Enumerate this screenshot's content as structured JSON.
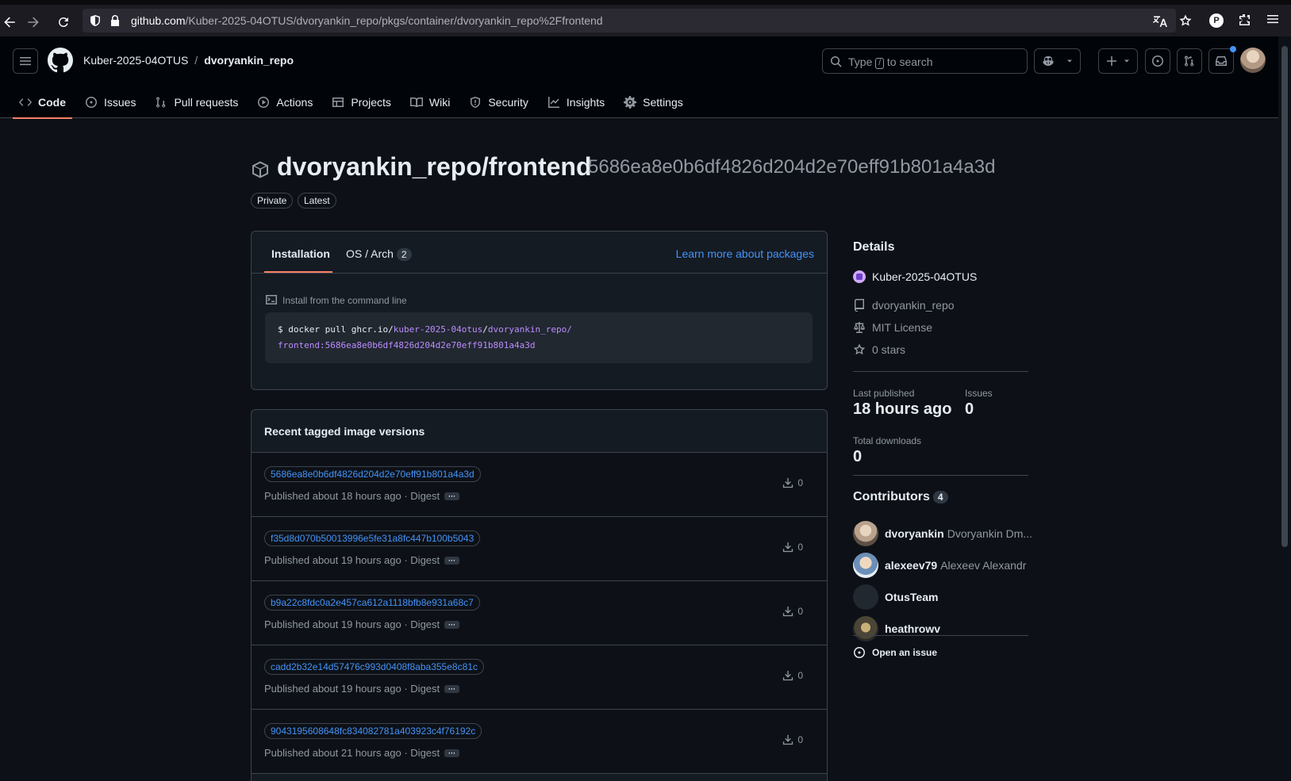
{
  "browser": {
    "url_host": "github.com",
    "url_path": "/Kuber-2025-04OTUS/dvoryankin_repo/pkgs/container/dvoryankin_repo%2Ffrontend",
    "profile_letter": "P"
  },
  "header": {
    "org": "Kuber-2025-04OTUS",
    "sep": "/",
    "repo": "dvoryankin_repo",
    "search_pre": "Type",
    "search_key": "/",
    "search_post": "to search"
  },
  "nav": {
    "tabs": [
      {
        "label": "Code",
        "icon": "code-icon"
      },
      {
        "label": "Issues",
        "icon": "issue-icon"
      },
      {
        "label": "Pull requests",
        "icon": "pull-request-icon"
      },
      {
        "label": "Actions",
        "icon": "play-icon"
      },
      {
        "label": "Projects",
        "icon": "table-icon"
      },
      {
        "label": "Wiki",
        "icon": "book-icon"
      },
      {
        "label": "Security",
        "icon": "shield-icon"
      },
      {
        "label": "Insights",
        "icon": "graph-icon"
      },
      {
        "label": "Settings",
        "icon": "gear-icon"
      }
    ]
  },
  "package": {
    "name": "dvoryankin_repo/frontend",
    "digest": "5686ea8e0b6df4826d204d2e70eff91b801a4a3d",
    "labels": [
      "Private",
      "Latest"
    ]
  },
  "install": {
    "tab_installation": "Installation",
    "tab_os": "OS / Arch",
    "os_count": "2",
    "learn_more": "Learn more about packages",
    "cmd_label": "Install from the command line",
    "cmd_prefix": "$ docker pull ghcr.io/",
    "cmd_owner": "kuber-2025-04otus",
    "cmd_slash": "/",
    "cmd_repo": "dvoryankin_repo/",
    "cmd_line2": "frontend:5686ea8e0b6df4826d204d2e70eff91b801a4a3d"
  },
  "versions": {
    "title": "Recent tagged image versions",
    "rows": [
      {
        "tag": "5686ea8e0b6df4826d204d2e70eff91b801a4a3d",
        "published": "Published about 18 hours ago · Digest",
        "downloads": "0"
      },
      {
        "tag": "f35d8d070b50013996e5fe31a8fc447b100b5043",
        "published": "Published about 19 hours ago · Digest",
        "downloads": "0"
      },
      {
        "tag": "b9a22c8fdc0a2e457ca612a1118bfb8e931a68c7",
        "published": "Published about 19 hours ago · Digest",
        "downloads": "0"
      },
      {
        "tag": "cadd2b32e14d57476c993d0408f8aba355e8c81c",
        "published": "Published about 19 hours ago · Digest",
        "downloads": "0"
      },
      {
        "tag": "9043195608648fc834082781a403923c4f76192c",
        "published": "Published about 21 hours ago · Digest",
        "downloads": "0"
      }
    ],
    "dots": "···"
  },
  "details": {
    "title": "Details",
    "org": "Kuber-2025-04OTUS",
    "repo": "dvoryankin_repo",
    "license": "MIT License",
    "stars": "0 stars",
    "last_published_label": "Last published",
    "last_published": "18 hours ago",
    "issues_label": "Issues",
    "issues": "0",
    "downloads_label": "Total downloads",
    "downloads": "0"
  },
  "contributors": {
    "title": "Contributors",
    "count": "4",
    "list": [
      {
        "login": "dvoryankin",
        "name": "Dvoryankin Dm..."
      },
      {
        "login": "alexeev79",
        "name": "Alexeev Alexandr"
      },
      {
        "login": "OtusTeam",
        "name": ""
      },
      {
        "login": "heathrowv",
        "name": ""
      }
    ],
    "open_issue": "Open an issue"
  },
  "colors": {
    "bg": "#0d1117",
    "accent_underline": "#f78166",
    "link": "#4493f8"
  }
}
